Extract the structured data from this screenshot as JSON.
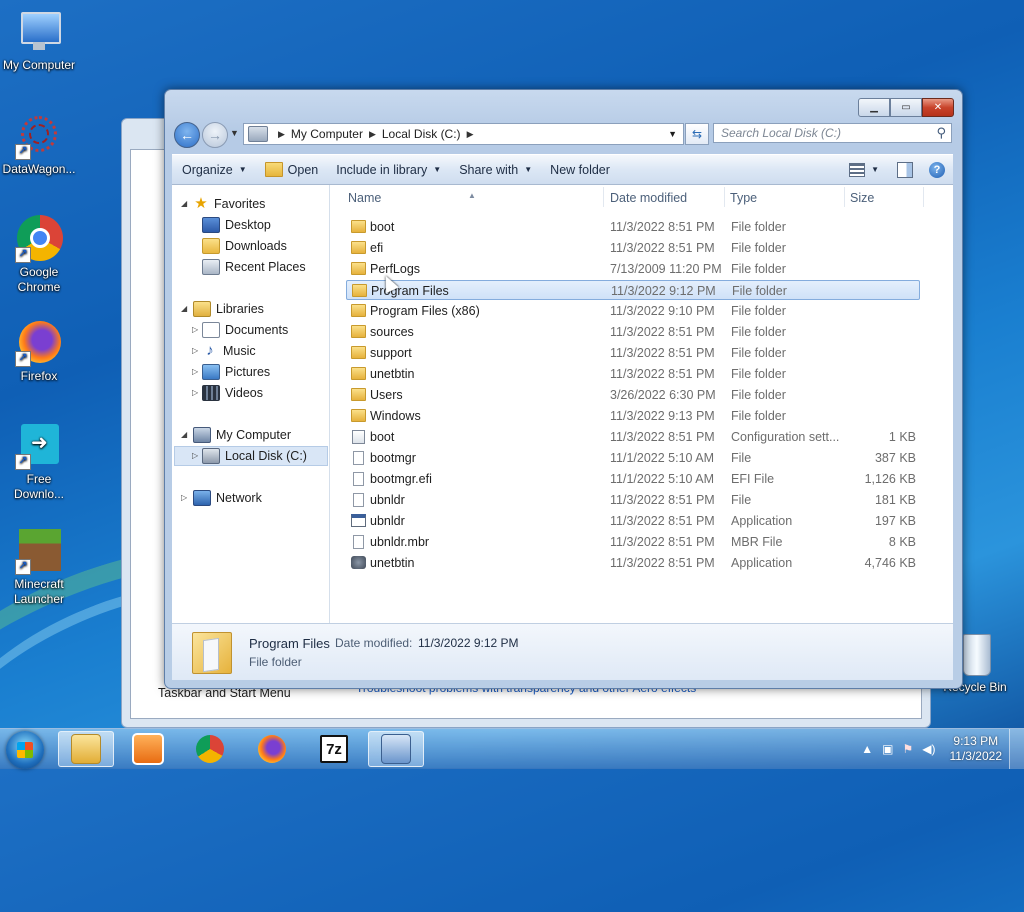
{
  "desktop": {
    "icons": [
      {
        "label": "My Computer",
        "icon": "computer-icon"
      },
      {
        "label": "DataWagon...",
        "icon": "datawagon-icon"
      },
      {
        "label": "Google Chrome",
        "icon": "chrome-icon"
      },
      {
        "label": "Firefox",
        "icon": "firefox-icon"
      },
      {
        "label": "Free Downlo...",
        "icon": "download-manager-icon"
      },
      {
        "label": "Minecraft Launcher",
        "icon": "minecraft-icon"
      },
      {
        "label": "Recycle Bin",
        "icon": "recycle-bin-icon"
      }
    ],
    "background_window": {
      "footer_text": "Taskbar and Start Menu",
      "link_text": "Troubleshoot problems with transparency and other Aero effects"
    }
  },
  "window": {
    "address": {
      "segments": [
        "My Computer",
        "Local Disk (C:)"
      ]
    },
    "search": {
      "placeholder": "Search Local Disk (C:)"
    },
    "toolbar": {
      "organize": "Organize",
      "open": "Open",
      "include_in_library": "Include in library",
      "share_with": "Share with",
      "new_folder": "New folder"
    },
    "nav": {
      "favorites": "Favorites",
      "desktop": "Desktop",
      "downloads": "Downloads",
      "recent_places": "Recent Places",
      "libraries": "Libraries",
      "documents": "Documents",
      "music": "Music",
      "pictures": "Pictures",
      "videos": "Videos",
      "my_computer": "My Computer",
      "local_disk": "Local Disk (C:)",
      "network": "Network"
    },
    "columns": {
      "name": "Name",
      "date_modified": "Date modified",
      "type": "Type",
      "size": "Size"
    },
    "files": [
      {
        "name": "boot",
        "date": "11/3/2022 8:51 PM",
        "type": "File folder",
        "size": "",
        "icon": "folder"
      },
      {
        "name": "efi",
        "date": "11/3/2022 8:51 PM",
        "type": "File folder",
        "size": "",
        "icon": "folder"
      },
      {
        "name": "PerfLogs",
        "date": "7/13/2009 11:20 PM",
        "type": "File folder",
        "size": "",
        "icon": "folder"
      },
      {
        "name": "Program Files",
        "date": "11/3/2022 9:12 PM",
        "type": "File folder",
        "size": "",
        "icon": "folder",
        "selected": true
      },
      {
        "name": "Program Files (x86)",
        "date": "11/3/2022 9:10 PM",
        "type": "File folder",
        "size": "",
        "icon": "folder"
      },
      {
        "name": "sources",
        "date": "11/3/2022 8:51 PM",
        "type": "File folder",
        "size": "",
        "icon": "folder"
      },
      {
        "name": "support",
        "date": "11/3/2022 8:51 PM",
        "type": "File folder",
        "size": "",
        "icon": "folder"
      },
      {
        "name": "unetbtin",
        "date": "11/3/2022 8:51 PM",
        "type": "File folder",
        "size": "",
        "icon": "folder"
      },
      {
        "name": "Users",
        "date": "3/26/2022 6:30 PM",
        "type": "File folder",
        "size": "",
        "icon": "folder"
      },
      {
        "name": "Windows",
        "date": "11/3/2022 9:13 PM",
        "type": "File folder",
        "size": "",
        "icon": "folder"
      },
      {
        "name": "boot",
        "date": "11/3/2022 8:51 PM",
        "type": "Configuration sett...",
        "size": "1 KB",
        "icon": "config"
      },
      {
        "name": "bootmgr",
        "date": "11/1/2022 5:10 AM",
        "type": "File",
        "size": "387 KB",
        "icon": "file"
      },
      {
        "name": "bootmgr.efi",
        "date": "11/1/2022 5:10 AM",
        "type": "EFI File",
        "size": "1,126 KB",
        "icon": "file"
      },
      {
        "name": "ubnldr",
        "date": "11/3/2022 8:51 PM",
        "type": "File",
        "size": "181 KB",
        "icon": "file"
      },
      {
        "name": "ubnldr",
        "date": "11/3/2022 8:51 PM",
        "type": "Application",
        "size": "197 KB",
        "icon": "app"
      },
      {
        "name": "ubnldr.mbr",
        "date": "11/3/2022 8:51 PM",
        "type": "MBR File",
        "size": "8 KB",
        "icon": "file"
      },
      {
        "name": "unetbtin",
        "date": "11/3/2022 8:51 PM",
        "type": "Application",
        "size": "4,746 KB",
        "icon": "setup"
      }
    ],
    "details": {
      "name": "Program Files",
      "date_label": "Date modified:",
      "date_value": "11/3/2022 9:12 PM",
      "type": "File folder"
    }
  },
  "taskbar": {
    "items": [
      "explorer-icon",
      "media-player-icon",
      "chrome-icon",
      "firefox-icon",
      "7zip-icon",
      "control-panel-icon"
    ],
    "clock": {
      "time": "9:13 PM",
      "date": "11/3/2022"
    }
  }
}
